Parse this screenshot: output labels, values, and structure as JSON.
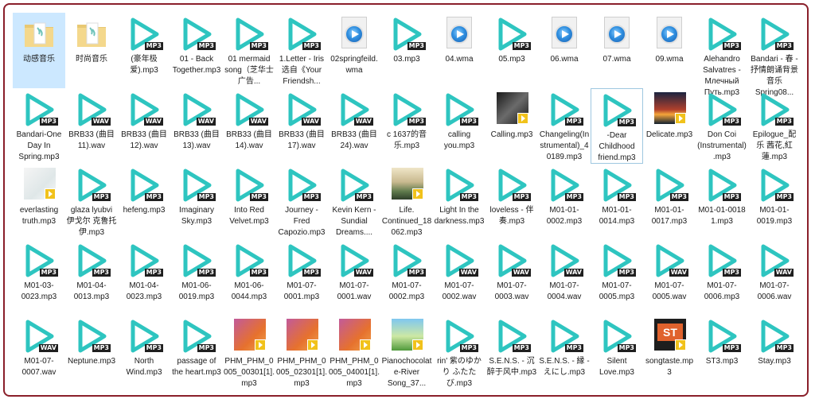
{
  "colors": {
    "play_teal": "#2ec5c0",
    "frame_border": "#8a1f2a",
    "selection": "#cce8ff",
    "folder": "#e8c873"
  },
  "files": [
    {
      "name": "动感音乐",
      "type": "folder",
      "selected": true
    },
    {
      "name": "时尚音乐",
      "type": "folder"
    },
    {
      "name": "(豪年极爱).mp3",
      "type": "play",
      "badge": "MP3"
    },
    {
      "name": "01 - Back Together.mp3",
      "type": "play",
      "badge": "MP3"
    },
    {
      "name": "01 mermaid song（芝华士广告...",
      "type": "play",
      "badge": "MP3"
    },
    {
      "name": "1.Letter - Iris 选自《Your Friendsh...",
      "type": "play",
      "badge": "MP3"
    },
    {
      "name": "02springfeild.wma",
      "type": "wma"
    },
    {
      "name": "03.mp3",
      "type": "play",
      "badge": "MP3"
    },
    {
      "name": "04.wma",
      "type": "wma"
    },
    {
      "name": "05.mp3",
      "type": "play",
      "badge": "MP3"
    },
    {
      "name": "06.wma",
      "type": "wma"
    },
    {
      "name": "07.wma",
      "type": "wma"
    },
    {
      "name": "09.wma",
      "type": "wma"
    },
    {
      "name": "Alehandro Salvatres - Млечный Путь.mp3",
      "type": "play",
      "badge": "MP3"
    },
    {
      "name": "Bandari - 春 - 抒情朗诵背景音乐Spring08...",
      "type": "play",
      "badge": "MP3"
    },
    {
      "name": "Bandari-One Day In Spring.mp3",
      "type": "play",
      "badge": "MP3"
    },
    {
      "name": "BRB33 (曲目 11).wav",
      "type": "play",
      "badge": "WAV"
    },
    {
      "name": "BRB33 (曲目 12).wav",
      "type": "play",
      "badge": "WAV"
    },
    {
      "name": "BRB33 (曲目 13).wav",
      "type": "play",
      "badge": "WAV"
    },
    {
      "name": "BRB33 (曲目 14).wav",
      "type": "play",
      "badge": "WAV"
    },
    {
      "name": "BRB33 (曲目 17).wav",
      "type": "play",
      "badge": "WAV"
    },
    {
      "name": "BRB33 (曲目 24).wav",
      "type": "play",
      "badge": "WAV"
    },
    {
      "name": "c 1637的音乐.mp3",
      "type": "play",
      "badge": "MP3"
    },
    {
      "name": "calling you.mp3",
      "type": "play",
      "badge": "MP3"
    },
    {
      "name": "Calling.mp3",
      "type": "art",
      "art": "eye"
    },
    {
      "name": "Changeling(Instrumental)_40189.mp3",
      "type": "play",
      "badge": "MP3"
    },
    {
      "name": "-Dear Childhood friend.mp3",
      "type": "play",
      "badge": "MP3",
      "outline": true
    },
    {
      "name": "Delicate.mp3",
      "type": "art",
      "art": "sunset"
    },
    {
      "name": "Don Coi (Instrumental).mp3",
      "type": "play",
      "badge": "MP3"
    },
    {
      "name": "Epilogue_配乐 茜花,紅蓮.mp3",
      "type": "play",
      "badge": "MP3"
    },
    {
      "name": "everlasting truth.mp3",
      "type": "art",
      "art": "pale"
    },
    {
      "name": "glaza lyubvi 伊戈尔 克鲁托伊.mp3",
      "type": "play",
      "badge": "MP3"
    },
    {
      "name": "hefeng.mp3",
      "type": "play",
      "badge": "MP3"
    },
    {
      "name": "Imaginary Sky.mp3",
      "type": "play",
      "badge": "MP3"
    },
    {
      "name": "Into Red Velvet.mp3",
      "type": "play",
      "badge": "MP3"
    },
    {
      "name": "Journey - Fred Capozio.mp3",
      "type": "play",
      "badge": "MP3"
    },
    {
      "name": "Kevin Kern - Sundial Dreams....",
      "type": "play",
      "badge": "MP3"
    },
    {
      "name": "Life. Continued_18062.mp3",
      "type": "art",
      "art": "landscape"
    },
    {
      "name": "Light In the darkness.mp3",
      "type": "play",
      "badge": "MP3"
    },
    {
      "name": "loveless - 伴奏.mp3",
      "type": "play",
      "badge": "MP3"
    },
    {
      "name": "M01-01-0002.mp3",
      "type": "play",
      "badge": "MP3"
    },
    {
      "name": "M01-01-0014.mp3",
      "type": "play",
      "badge": "MP3"
    },
    {
      "name": "M01-01-0017.mp3",
      "type": "play",
      "badge": "MP3"
    },
    {
      "name": "M01-01-0018 1.mp3",
      "type": "play",
      "badge": "MP3"
    },
    {
      "name": "M01-01-0019.mp3",
      "type": "play",
      "badge": "MP3"
    },
    {
      "name": "M01-03-0023.mp3",
      "type": "play",
      "badge": "MP3"
    },
    {
      "name": "M01-04-0013.mp3",
      "type": "play",
      "badge": "MP3"
    },
    {
      "name": "M01-04-0023.mp3",
      "type": "play",
      "badge": "MP3"
    },
    {
      "name": "M01-06-0019.mp3",
      "type": "play",
      "badge": "MP3"
    },
    {
      "name": "M01-06-0044.mp3",
      "type": "play",
      "badge": "MP3"
    },
    {
      "name": "M01-07-0001.mp3",
      "type": "play",
      "badge": "MP3"
    },
    {
      "name": "M01-07-0001.wav",
      "type": "play",
      "badge": "WAV"
    },
    {
      "name": "M01-07-0002.mp3",
      "type": "play",
      "badge": "MP3"
    },
    {
      "name": "M01-07-0002.wav",
      "type": "play",
      "badge": "WAV"
    },
    {
      "name": "M01-07-0003.wav",
      "type": "play",
      "badge": "WAV"
    },
    {
      "name": "M01-07-0004.wav",
      "type": "play",
      "badge": "WAV"
    },
    {
      "name": "M01-07-0005.mp3",
      "type": "play",
      "badge": "MP3"
    },
    {
      "name": "M01-07-0005.wav",
      "type": "play",
      "badge": "WAV"
    },
    {
      "name": "M01-07-0006.mp3",
      "type": "play",
      "badge": "MP3"
    },
    {
      "name": "M01-07-0006.wav",
      "type": "play",
      "badge": "WAV"
    },
    {
      "name": "M01-07-0007.wav",
      "type": "play",
      "badge": "WAV"
    },
    {
      "name": "Neptune.mp3",
      "type": "play",
      "badge": "MP3"
    },
    {
      "name": "North Wind.mp3",
      "type": "play",
      "badge": "MP3"
    },
    {
      "name": "passage of the heart.mp3",
      "type": "play",
      "badge": "MP3"
    },
    {
      "name": "PHM_PHM_0005_00301[1].mp3",
      "type": "art",
      "art": "phm"
    },
    {
      "name": "PHM_PHM_0005_02301[1].mp3",
      "type": "art",
      "art": "phm"
    },
    {
      "name": "PHM_PHM_0005_04001[1].mp3",
      "type": "art",
      "art": "phm"
    },
    {
      "name": "Pianochocolate-River Song_37...",
      "type": "art",
      "art": "garden"
    },
    {
      "name": "rin' 紫のゆかり ふたたび.mp3",
      "type": "play",
      "badge": "MP3"
    },
    {
      "name": "S.E.N.S. - 沉醉于风中.mp3",
      "type": "play",
      "badge": "MP3"
    },
    {
      "name": "S.E.N.S. - 縁 - えにし.mp3",
      "type": "play",
      "badge": "MP3"
    },
    {
      "name": "Silent Love.mp3",
      "type": "play",
      "badge": "MP3"
    },
    {
      "name": "songtaste.mp3",
      "type": "art",
      "art": "st",
      "art_text": "ST"
    },
    {
      "name": "ST3.mp3",
      "type": "play",
      "badge": "MP3"
    },
    {
      "name": "Stay.mp3",
      "type": "play",
      "badge": "MP3"
    }
  ]
}
